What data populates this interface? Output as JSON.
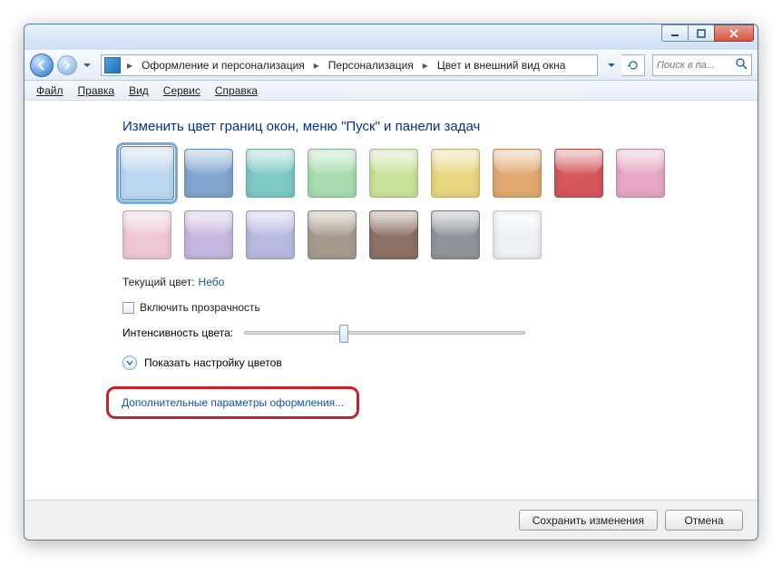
{
  "breadcrumbs": [
    "Оформление и персонализация",
    "Персонализация",
    "Цвет и внешний вид окна"
  ],
  "search": {
    "placeholder": "Поиск в па..."
  },
  "menu": {
    "file": "Файл",
    "edit": "Правка",
    "view": "Вид",
    "tools": "Сервис",
    "help": "Справка"
  },
  "heading": "Изменить цвет границ окон, меню \"Пуск\" и панели задач",
  "colors": [
    {
      "name": "Небо",
      "hex": "#bcd7ef",
      "selected": true
    },
    {
      "name": "twilight",
      "hex": "#7fa6cf"
    },
    {
      "name": "sea",
      "hex": "#7ec9c4"
    },
    {
      "name": "leaf",
      "hex": "#a8dcb0"
    },
    {
      "name": "lime",
      "hex": "#c8e29a"
    },
    {
      "name": "sun",
      "hex": "#e7d77f"
    },
    {
      "name": "pumpkin",
      "hex": "#e0a86f"
    },
    {
      "name": "ruby",
      "hex": "#d4575c"
    },
    {
      "name": "fuchsia",
      "hex": "#e6a6c4"
    },
    {
      "name": "blush",
      "hex": "#efc7d5"
    },
    {
      "name": "violet",
      "hex": "#c7b6df"
    },
    {
      "name": "lavender",
      "hex": "#b7b9e0"
    },
    {
      "name": "taupe",
      "hex": "#a79a8d"
    },
    {
      "name": "chocolate",
      "hex": "#8d7166"
    },
    {
      "name": "slate",
      "hex": "#8f9499"
    },
    {
      "name": "frost",
      "hex": "#eef1f3"
    }
  ],
  "current_color_label": "Текущий цвет:",
  "current_color_value": "Небо",
  "transparency_label": "Включить прозрачность",
  "intensity_label": "Интенсивность цвета:",
  "show_mixer_label": "Показать настройку цветов",
  "advanced_link": "Дополнительные параметры оформления...",
  "buttons": {
    "save": "Сохранить изменения",
    "cancel": "Отмена"
  }
}
